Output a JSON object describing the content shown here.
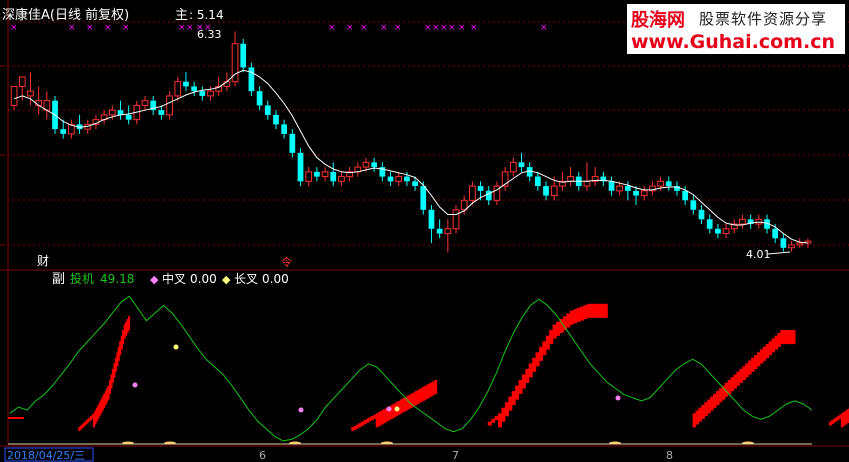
{
  "header": {
    "stock_title": "深康佳A(日线 前复权)",
    "main_label": "主",
    "main_value": ": 5.14"
  },
  "markers": {
    "high_label": "6.33",
    "low_label": "4.01",
    "cai_label": "财",
    "event_glyph": "令"
  },
  "sub_panel": {
    "panel_label": "副",
    "series": [
      {
        "name": "投机",
        "value": "49.18",
        "color": "#19c519"
      },
      {
        "name": "中叉",
        "value": "0.00",
        "color": "#ff80ff"
      },
      {
        "name": "长叉",
        "value": "0.00",
        "color": "#ffff80"
      }
    ]
  },
  "date_axis": {
    "current_date": "2018/04/25/三",
    "month_labels": [
      "6",
      "7",
      "8"
    ]
  },
  "banner": {
    "site_name": "股海网",
    "slogan": "股票软件资源分享",
    "url": "www.Guhai.com.cn"
  },
  "colors": {
    "up": "#ff3232",
    "down": "#00ffff",
    "grid": "#800000",
    "ma": "#ffffff",
    "cross_mark": "#ff00ff",
    "red_block": "#ff0000"
  },
  "chart_data": [
    {
      "type": "candlestick",
      "title": "深康佳A(日线 前复权)",
      "y_range": [
        3.9,
        6.45
      ],
      "candles": [
        [
          5.55,
          5.75,
          5.7,
          5.5
        ],
        [
          5.75,
          5.85,
          5.8,
          5.6
        ],
        [
          5.65,
          5.7,
          5.9,
          5.55
        ],
        [
          5.55,
          5.6,
          5.75,
          5.45
        ],
        [
          5.5,
          5.6,
          5.7,
          5.4
        ],
        [
          5.6,
          5.3,
          5.65,
          5.25
        ],
        [
          5.3,
          5.25,
          5.4,
          5.2
        ],
        [
          5.25,
          5.35,
          5.4,
          5.2
        ],
        [
          5.35,
          5.3,
          5.45,
          5.25
        ],
        [
          5.3,
          5.35,
          5.4,
          5.25
        ],
        [
          5.35,
          5.4,
          5.45,
          5.3
        ],
        [
          5.4,
          5.45,
          5.5,
          5.35
        ],
        [
          5.45,
          5.5,
          5.55,
          5.4
        ],
        [
          5.5,
          5.45,
          5.6,
          5.4
        ],
        [
          5.45,
          5.4,
          5.55,
          5.35
        ],
        [
          5.4,
          5.55,
          5.6,
          5.35
        ],
        [
          5.55,
          5.6,
          5.65,
          5.5
        ],
        [
          5.6,
          5.5,
          5.65,
          5.45
        ],
        [
          5.5,
          5.45,
          5.55,
          5.4
        ],
        [
          5.45,
          5.65,
          5.7,
          5.4
        ],
        [
          5.65,
          5.8,
          5.85,
          5.6
        ],
        [
          5.8,
          5.75,
          5.9,
          5.7
        ],
        [
          5.75,
          5.7,
          5.8,
          5.65
        ],
        [
          5.7,
          5.65,
          5.75,
          5.6
        ],
        [
          5.65,
          5.7,
          5.75,
          5.6
        ],
        [
          5.7,
          5.75,
          5.85,
          5.65
        ],
        [
          5.75,
          5.8,
          5.9,
          5.7
        ],
        [
          5.8,
          6.2,
          6.33,
          5.75
        ],
        [
          6.2,
          5.95,
          6.25,
          5.9
        ],
        [
          5.95,
          5.7,
          6.0,
          5.65
        ],
        [
          5.7,
          5.55,
          5.75,
          5.5
        ],
        [
          5.55,
          5.45,
          5.6,
          5.4
        ],
        [
          5.45,
          5.35,
          5.5,
          5.3
        ],
        [
          5.35,
          5.25,
          5.4,
          5.2
        ],
        [
          5.25,
          5.05,
          5.3,
          5.0
        ],
        [
          5.05,
          4.75,
          5.1,
          4.7
        ],
        [
          4.75,
          4.85,
          4.9,
          4.7
        ],
        [
          4.85,
          4.8,
          4.9,
          4.75
        ],
        [
          4.8,
          4.85,
          4.9,
          4.75
        ],
        [
          4.85,
          4.75,
          4.95,
          4.7
        ],
        [
          4.75,
          4.8,
          4.85,
          4.7
        ],
        [
          4.8,
          4.85,
          4.9,
          4.75
        ],
        [
          4.85,
          4.9,
          4.95,
          4.8
        ],
        [
          4.9,
          4.95,
          5.0,
          4.85
        ],
        [
          4.95,
          4.9,
          5.0,
          4.85
        ],
        [
          4.9,
          4.8,
          4.95,
          4.75
        ],
        [
          4.8,
          4.75,
          4.85,
          4.7
        ],
        [
          4.75,
          4.8,
          4.85,
          4.7
        ],
        [
          4.8,
          4.75,
          4.85,
          4.7
        ],
        [
          4.75,
          4.7,
          4.8,
          4.65
        ],
        [
          4.7,
          4.45,
          4.75,
          4.4
        ],
        [
          4.45,
          4.25,
          4.5,
          4.1
        ],
        [
          4.25,
          4.2,
          4.35,
          4.15
        ],
        [
          4.2,
          4.25,
          4.35,
          4.0
        ],
        [
          4.25,
          4.45,
          4.5,
          4.2
        ],
        [
          4.45,
          4.55,
          4.6,
          4.4
        ],
        [
          4.55,
          4.7,
          4.75,
          4.5
        ],
        [
          4.7,
          4.65,
          4.75,
          4.55
        ],
        [
          4.65,
          4.55,
          4.7,
          4.5
        ],
        [
          4.55,
          4.7,
          4.75,
          4.5
        ],
        [
          4.7,
          4.85,
          4.9,
          4.65
        ],
        [
          4.85,
          4.95,
          5.0,
          4.8
        ],
        [
          4.95,
          4.9,
          5.05,
          4.85
        ],
        [
          4.9,
          4.8,
          4.95,
          4.75
        ],
        [
          4.8,
          4.7,
          4.85,
          4.65
        ],
        [
          4.7,
          4.6,
          4.75,
          4.55
        ],
        [
          4.6,
          4.7,
          4.8,
          4.55
        ],
        [
          4.7,
          4.75,
          4.85,
          4.65
        ],
        [
          4.75,
          4.8,
          4.9,
          4.7
        ],
        [
          4.8,
          4.7,
          4.85,
          4.65
        ],
        [
          4.7,
          4.75,
          4.95,
          4.65
        ],
        [
          4.75,
          4.8,
          4.9,
          4.7
        ],
        [
          4.8,
          4.75,
          4.85,
          4.7
        ],
        [
          4.75,
          4.65,
          4.8,
          4.6
        ],
        [
          4.65,
          4.7,
          4.75,
          4.6
        ],
        [
          4.7,
          4.65,
          4.75,
          4.55
        ],
        [
          4.65,
          4.6,
          4.7,
          4.5
        ],
        [
          4.6,
          4.65,
          4.7,
          4.55
        ],
        [
          4.65,
          4.7,
          4.75,
          4.6
        ],
        [
          4.7,
          4.75,
          4.8,
          4.65
        ],
        [
          4.75,
          4.7,
          4.8,
          4.65
        ],
        [
          4.7,
          4.65,
          4.75,
          4.6
        ],
        [
          4.65,
          4.55,
          4.7,
          4.5
        ],
        [
          4.55,
          4.45,
          4.6,
          4.4
        ],
        [
          4.45,
          4.35,
          4.5,
          4.3
        ],
        [
          4.35,
          4.25,
          4.4,
          4.2
        ],
        [
          4.25,
          4.2,
          4.3,
          4.15
        ],
        [
          4.2,
          4.25,
          4.3,
          4.15
        ],
        [
          4.25,
          4.3,
          4.35,
          4.2
        ],
        [
          4.3,
          4.35,
          4.4,
          4.25
        ],
        [
          4.35,
          4.3,
          4.4,
          4.25
        ],
        [
          4.3,
          4.35,
          4.4,
          4.25
        ],
        [
          4.35,
          4.25,
          4.4,
          4.2
        ],
        [
          4.25,
          4.15,
          4.3,
          4.1
        ],
        [
          4.15,
          4.05,
          4.2,
          4.01
        ],
        [
          4.05,
          4.08,
          4.12,
          4.01
        ],
        [
          4.08,
          4.1,
          4.15,
          4.05
        ],
        [
          4.1,
          4.12,
          4.15,
          4.05
        ]
      ],
      "ma": [
        5.62,
        5.65,
        5.62,
        5.55,
        5.5,
        5.45,
        5.38,
        5.34,
        5.32,
        5.33,
        5.36,
        5.4,
        5.43,
        5.45,
        5.46,
        5.48,
        5.5,
        5.52,
        5.54,
        5.58,
        5.62,
        5.66,
        5.69,
        5.71,
        5.72,
        5.74,
        5.8,
        5.88,
        5.92,
        5.9,
        5.85,
        5.78,
        5.68,
        5.57,
        5.44,
        5.28,
        5.12,
        5.0,
        4.93,
        4.88,
        4.85,
        4.84,
        4.85,
        4.87,
        4.89,
        4.88,
        4.86,
        4.84,
        4.82,
        4.79,
        4.71,
        4.6,
        4.48,
        4.4,
        4.4,
        4.44,
        4.52,
        4.58,
        4.62,
        4.66,
        4.72,
        4.78,
        4.84,
        4.86,
        4.84,
        4.8,
        4.76,
        4.74,
        4.75,
        4.75,
        4.75,
        4.76,
        4.76,
        4.75,
        4.73,
        4.71,
        4.68,
        4.66,
        4.66,
        4.68,
        4.69,
        4.69,
        4.66,
        4.61,
        4.53,
        4.45,
        4.37,
        4.31,
        4.29,
        4.29,
        4.31,
        4.32,
        4.31,
        4.27,
        4.2,
        4.14,
        4.11,
        4.1
      ]
    },
    {
      "type": "line",
      "series_name": "投机",
      "y_range": [
        0,
        100
      ],
      "values": [
        20,
        24,
        22,
        28,
        32,
        38,
        45,
        52,
        60,
        66,
        72,
        78,
        85,
        92,
        96,
        88,
        80,
        85,
        90,
        85,
        78,
        70,
        62,
        55,
        50,
        45,
        38,
        30,
        22,
        15,
        10,
        5,
        2,
        3,
        6,
        10,
        16,
        24,
        30,
        36,
        42,
        48,
        52,
        50,
        44,
        38,
        32,
        26,
        22,
        18,
        14,
        10,
        8,
        10,
        16,
        24,
        34,
        46,
        60,
        72,
        82,
        90,
        94,
        90,
        84,
        76,
        68,
        60,
        52,
        46,
        40,
        36,
        32,
        30,
        28,
        30,
        36,
        42,
        48,
        52,
        55,
        52,
        46,
        40,
        34,
        28,
        22,
        18,
        16,
        18,
        22,
        26,
        28,
        26,
        22
      ]
    },
    {
      "type": "bar",
      "series_name": "red_blocks",
      "y_range": [
        0,
        100
      ],
      "segments": [
        {
          "x": [
            8,
            14
          ],
          "levels": [
            10,
            11,
            12,
            13,
            14,
            15,
            16,
            17,
            18,
            19,
            20,
            22,
            24,
            26,
            28,
            30,
            32,
            34,
            36,
            38,
            40,
            44,
            48,
            52,
            56,
            60,
            64,
            68,
            72,
            76,
            80,
            84,
            86,
            88,
            90
          ]
        },
        {
          "x": [
            40,
            50
          ],
          "levels": [
            10,
            11,
            12,
            13,
            14,
            15,
            16,
            17,
            18,
            19,
            20,
            21,
            22,
            23,
            24,
            25,
            26,
            27,
            28,
            29,
            30,
            31,
            32,
            33,
            34,
            35,
            36,
            37,
            38,
            39,
            40,
            41,
            42,
            43,
            44
          ]
        },
        {
          "x": [
            56,
            70
          ],
          "levels": [
            14,
            16,
            18,
            20,
            24,
            28,
            32,
            36,
            40,
            44,
            48,
            52,
            56,
            60,
            64,
            68,
            72,
            76,
            80,
            84,
            86,
            88,
            90,
            92,
            94,
            95,
            96,
            97,
            98,
            99,
            99,
            99,
            99,
            99,
            99
          ]
        },
        {
          "x": [
            80,
            92
          ],
          "levels": [
            20,
            22,
            24,
            26,
            28,
            30,
            32,
            34,
            36,
            38,
            40,
            42,
            44,
            46,
            48,
            50,
            52,
            54,
            56,
            58,
            60,
            62,
            64,
            66,
            68,
            70,
            72,
            74,
            76,
            78,
            80,
            80,
            80,
            80,
            80
          ]
        },
        {
          "x": [
            96,
            104
          ],
          "levels": [
            14,
            15,
            16,
            17,
            18,
            19,
            20,
            21,
            22,
            23,
            24,
            25,
            26,
            27,
            28,
            29,
            30,
            31,
            32,
            33,
            34,
            35,
            36,
            37,
            38,
            39,
            40,
            41,
            42,
            43,
            44,
            44,
            44,
            44,
            44
          ]
        }
      ]
    }
  ]
}
